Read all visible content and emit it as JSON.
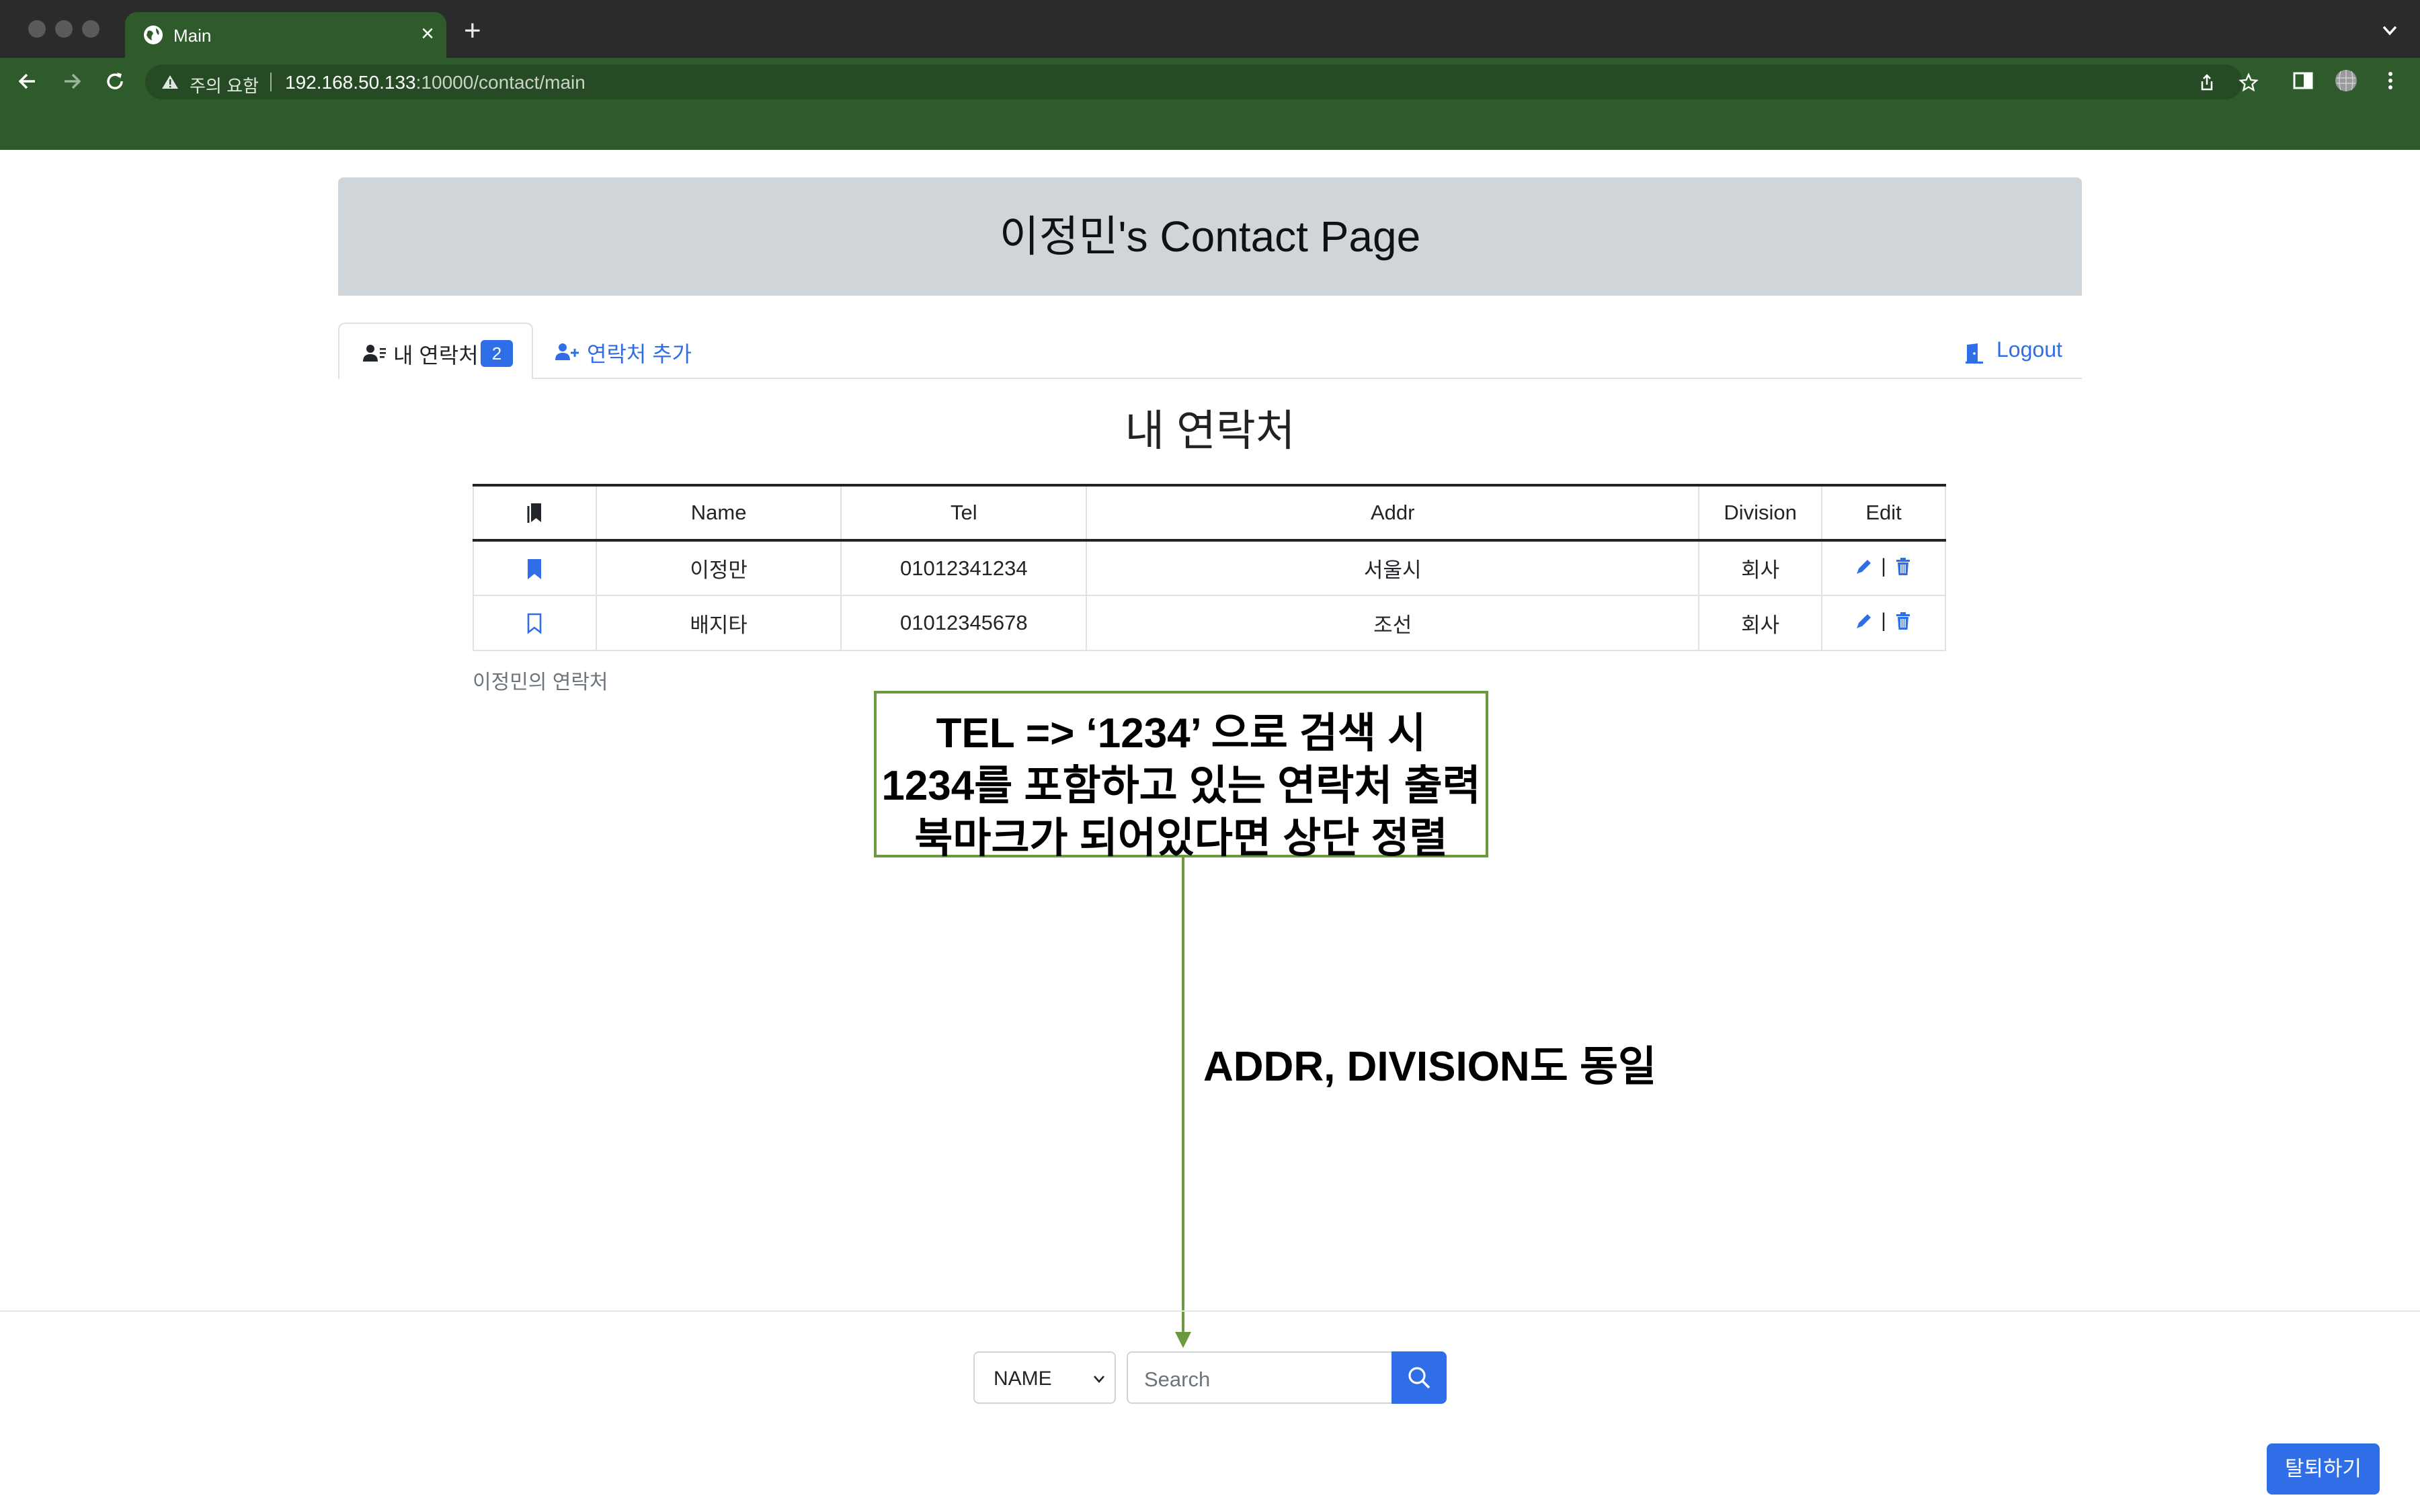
{
  "browser": {
    "tab_title": "Main",
    "new_tab_symbol": "+",
    "close_symbol": "×",
    "security_warning": "주의 요함",
    "url_host": "192.168.50.133",
    "url_rest": ":10000/contact/main"
  },
  "page": {
    "header_title": "이정민's Contact Page",
    "tabs": [
      {
        "label": "내 연락처",
        "badge": "2"
      },
      {
        "label": "연락처 추가"
      }
    ],
    "logout_label": "Logout",
    "section_title": "내 연락처",
    "caption": "이정민의 연락처"
  },
  "table": {
    "columns": [
      "Name",
      "Tel",
      "Addr",
      "Division",
      "Edit"
    ],
    "rows": [
      {
        "bookmarked": true,
        "name": "이정만",
        "tel": "01012341234",
        "addr": "서울시",
        "division": "회사"
      },
      {
        "bookmarked": false,
        "name": "배지타",
        "tel": "01012345678",
        "addr": "조선",
        "division": "회사"
      }
    ],
    "edit_separator": "|"
  },
  "annotation": {
    "lines": [
      "TEL => ‘1234’ 으로 검색 시",
      "1234를 포함하고 있는 연락처 출력",
      "북마크가 되어있다면 상단 정렬"
    ],
    "note": "ADDR, DIVISION도 동일"
  },
  "search": {
    "field_value": "NAME",
    "placeholder": "Search"
  },
  "withdraw_label": "탈퇴하기",
  "colors": {
    "chrome_green": "#2f5b2c",
    "accent_blue": "#2f6ee6",
    "header_gray": "#d0d5da",
    "annotation_green": "#6a9a3b"
  },
  "icons": [
    "globe-icon",
    "close-icon",
    "plus-icon",
    "back-icon",
    "forward-icon",
    "reload-icon",
    "warning-icon",
    "share-icon",
    "star-icon",
    "sidebar-icon",
    "profile-icon",
    "kebab-icon",
    "contacts-icon",
    "add-user-icon",
    "door-icon",
    "bookmarks-icon",
    "bookmark-icon",
    "pencil-icon",
    "trash-icon",
    "search-icon"
  ]
}
